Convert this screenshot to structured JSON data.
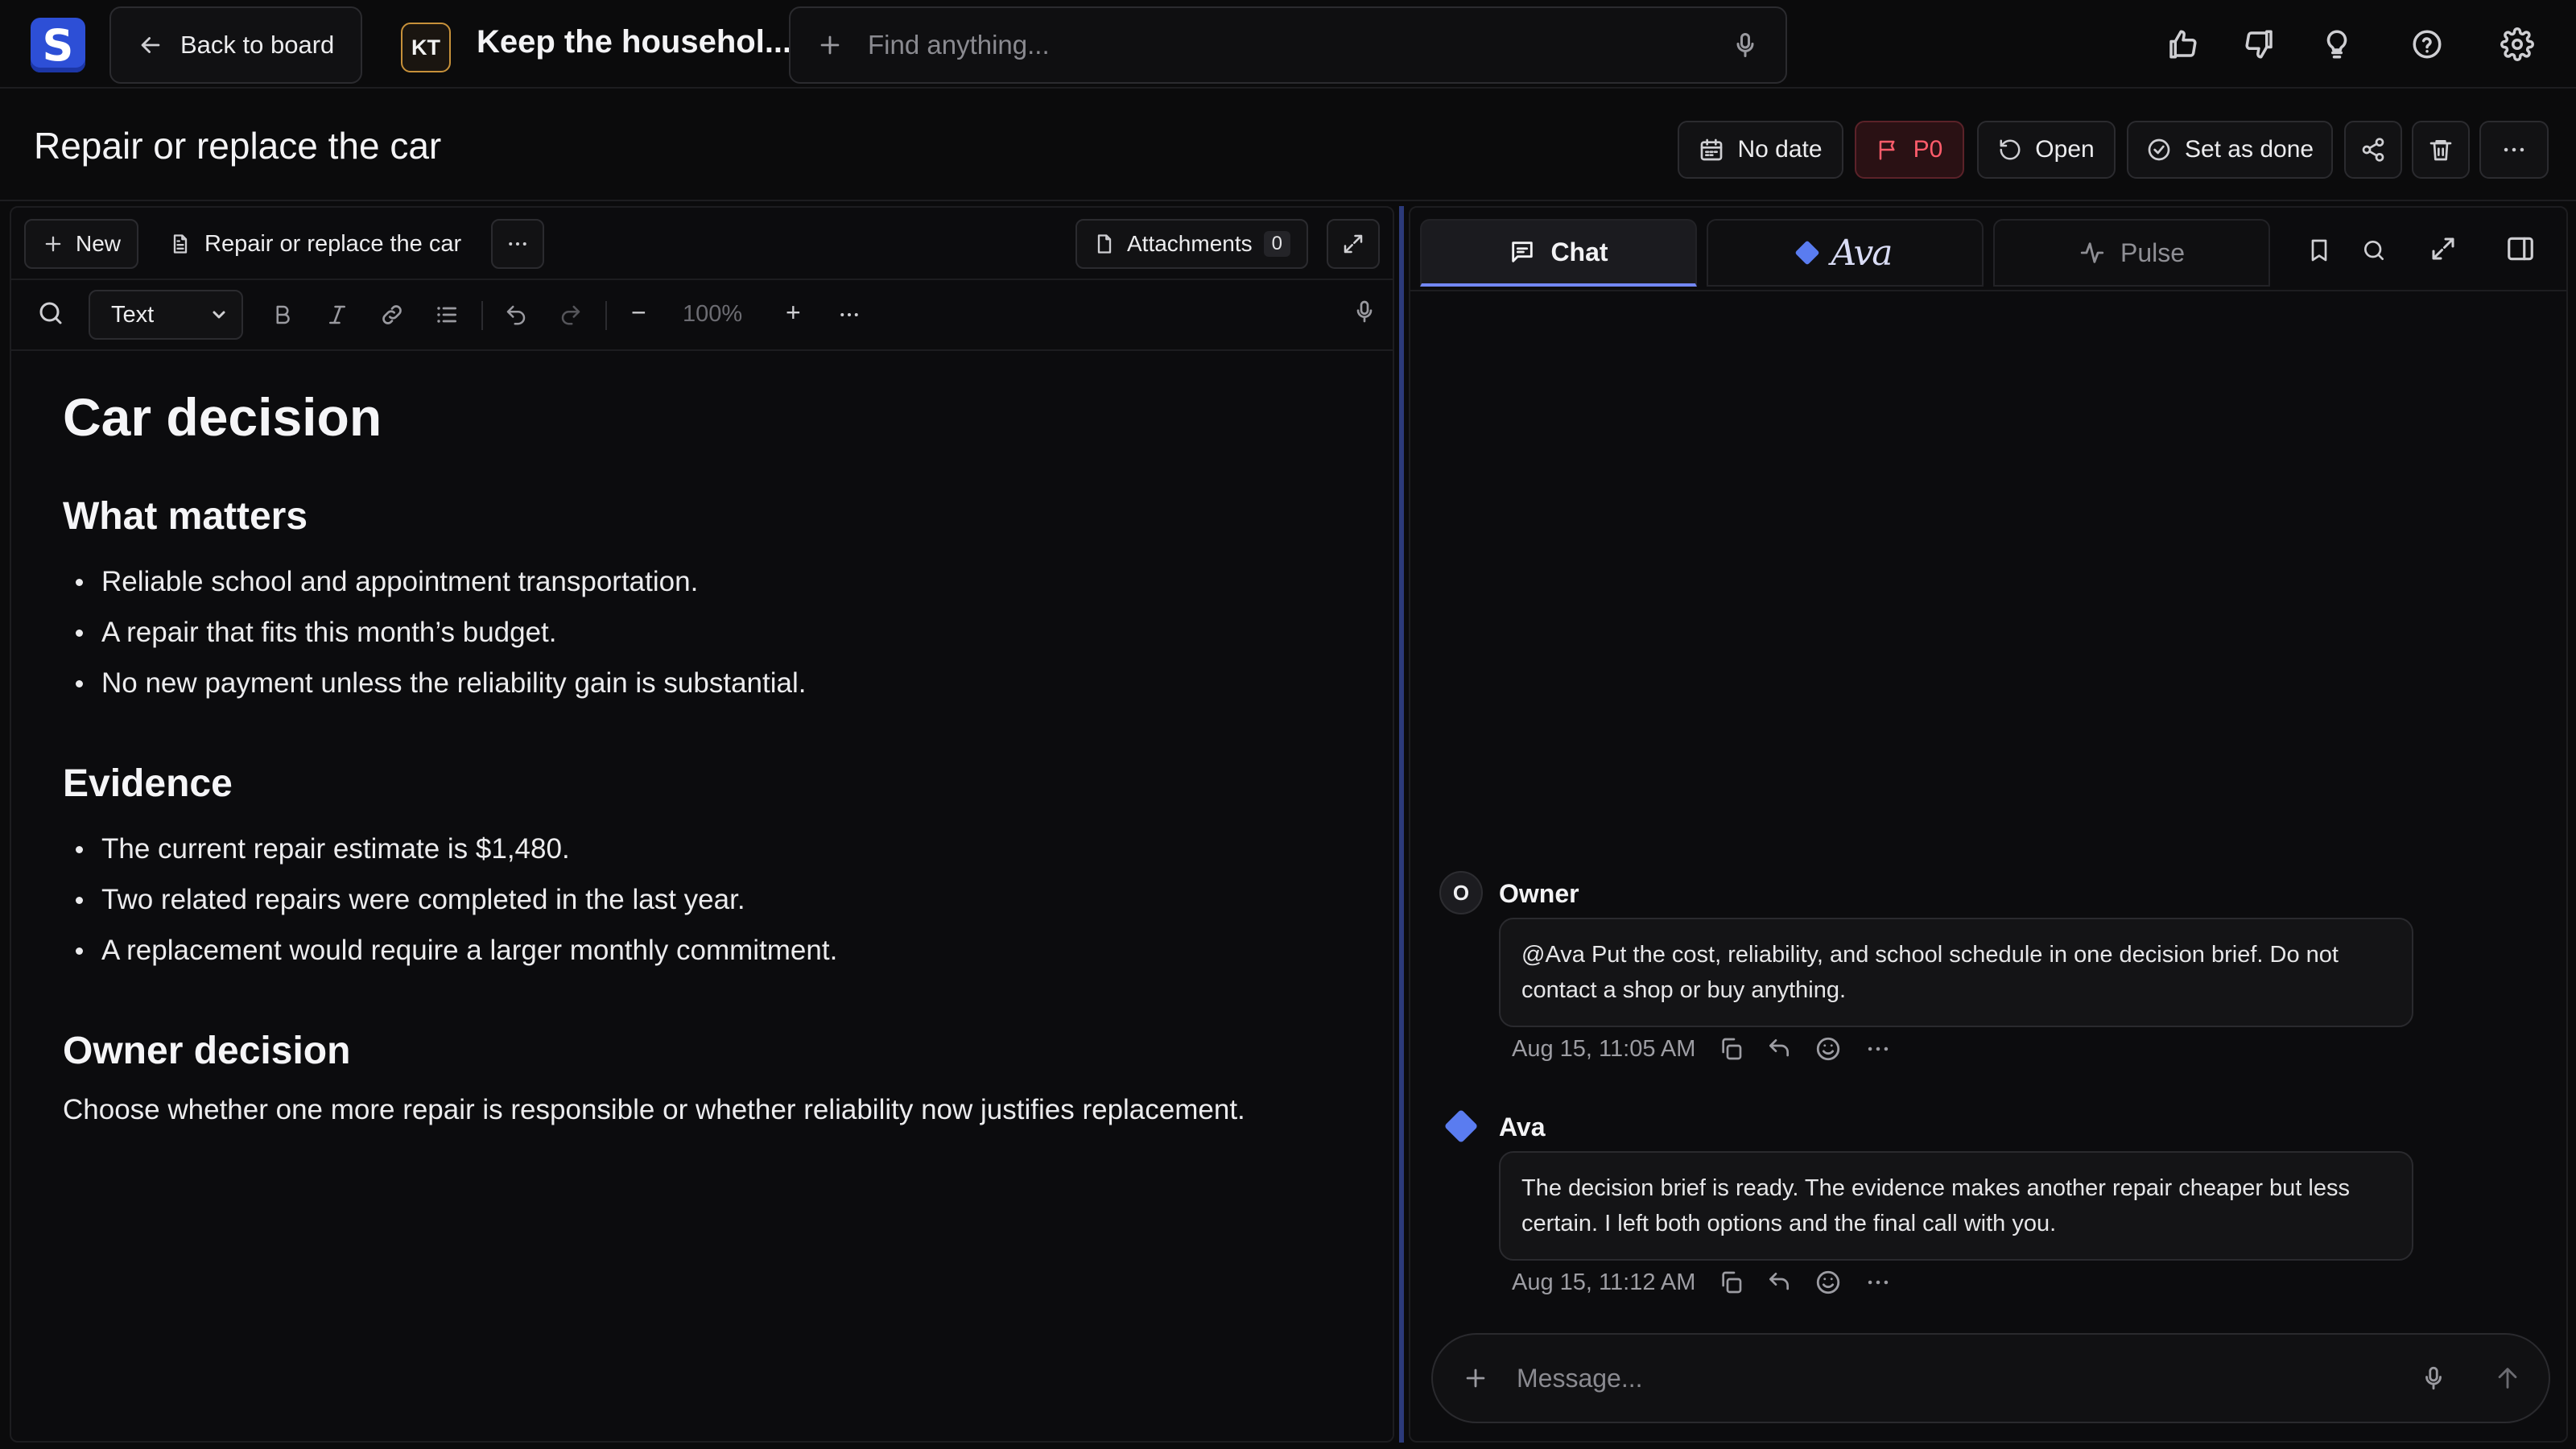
{
  "header": {
    "back_label": "Back to board",
    "board_initials": "KT",
    "board_title": "Keep the househol...",
    "search_placeholder": "Find anything..."
  },
  "task": {
    "title": "Repair or replace the car",
    "date_label": "No date",
    "priority_label": "P0",
    "status_label": "Open",
    "done_label": "Set as done"
  },
  "editor": {
    "new_label": "New",
    "doc_tab_label": "Repair or replace the car",
    "attachments_label": "Attachments",
    "attachments_count": "0",
    "format_value": "Text",
    "zoom": "100%",
    "zoom_minus": "−",
    "zoom_plus": "+",
    "doc": {
      "h1": "Car decision",
      "sections": [
        {
          "heading": "What matters",
          "items": [
            "Reliable school and appointment transportation.",
            "A repair that fits this month’s budget.",
            "No new payment unless the reliability gain is substantial."
          ]
        },
        {
          "heading": "Evidence",
          "items": [
            "The current repair estimate is $1,480.",
            "Two related repairs were completed in the last year.",
            "A replacement would require a larger monthly commitment."
          ]
        },
        {
          "heading": "Owner decision",
          "paragraph": "Choose whether one more repair is responsible or whether reliability now justifies replacement."
        }
      ]
    }
  },
  "chat": {
    "tabs": {
      "chat": "Chat",
      "ava": "Ava",
      "pulse": "Pulse"
    },
    "messages": [
      {
        "author": "Owner",
        "avatar": "O",
        "text": "@Ava Put the cost, reliability, and school schedule in one decision brief. Do not contact a shop or buy anything.",
        "time": "Aug 15, 11:05 AM"
      },
      {
        "author": "Ava",
        "text": "The decision brief is ready. The evidence makes another repair cheaper but less certain. I left both options and the final call with you.",
        "time": "Aug 15, 11:12 AM"
      }
    ],
    "composer_placeholder": "Message..."
  },
  "colors": {
    "accent": "#5a7cf0",
    "priority": "#ff5c6b",
    "kt_border": "#c7913a",
    "logo_bg": "#2d4fd6"
  }
}
